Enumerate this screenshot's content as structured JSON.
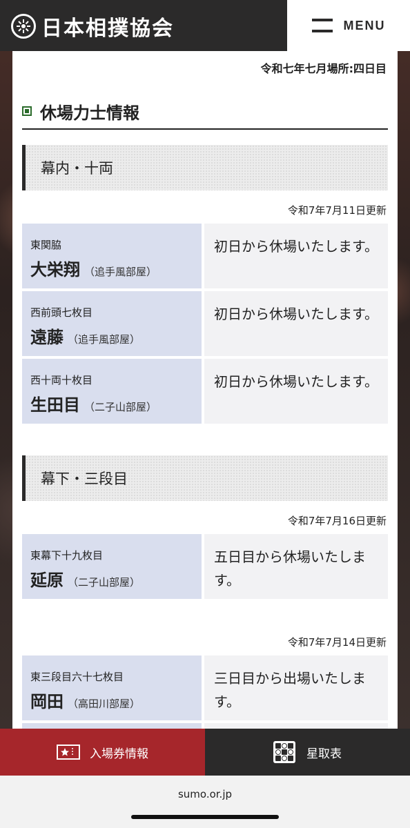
{
  "header": {
    "logo_text": "日本相撲協会",
    "menu_label": "MENU"
  },
  "page": {
    "date_line": "令和七年七月場所:四日目",
    "section_title": "休場力士情報"
  },
  "divisions": [
    {
      "label": "幕内・十両",
      "groups": [
        {
          "updated": "令和7年7月11日更新",
          "rows": [
            {
              "rank": "東関脇",
              "name": "大栄翔",
              "stable": "（追手風部屋）",
              "status": "初日から休場いたします。"
            },
            {
              "rank": "西前頭七枚目",
              "name": "遠藤",
              "stable": "（追手風部屋）",
              "status": "初日から休場いたします。"
            },
            {
              "rank": "西十両十枚目",
              "name": "生田目",
              "stable": "（二子山部屋）",
              "status": "初日から休場いたします。"
            }
          ]
        }
      ]
    },
    {
      "label": "幕下・三段目",
      "groups": [
        {
          "updated": "令和7年7月16日更新",
          "rows": [
            {
              "rank": "東幕下十九枚目",
              "name": "延原",
              "stable": "（二子山部屋）",
              "status": "五日目から休場いたします。"
            }
          ]
        },
        {
          "updated": "令和7年7月14日更新",
          "rows": [
            {
              "rank": "東三段目六十七枚目",
              "name": "岡田",
              "stable": "（高田川部屋）",
              "status": "三日目から出場いたします。"
            }
          ]
        }
      ]
    }
  ],
  "bottom_nav": {
    "tickets_label": "入場券情報",
    "results_label": "星取表"
  },
  "browser": {
    "url": "sumo.or.jp"
  },
  "colors": {
    "header_bg": "#2b2a2a",
    "tickets_bg": "#a6262b",
    "name_cell_bg": "#d9deee"
  },
  "icons": {
    "logo": "sumo-emblem-icon",
    "menu": "hamburger-icon",
    "section": "square-bullet-icon",
    "tickets": "ticket-icon",
    "results": "torikumi-grid-icon"
  }
}
